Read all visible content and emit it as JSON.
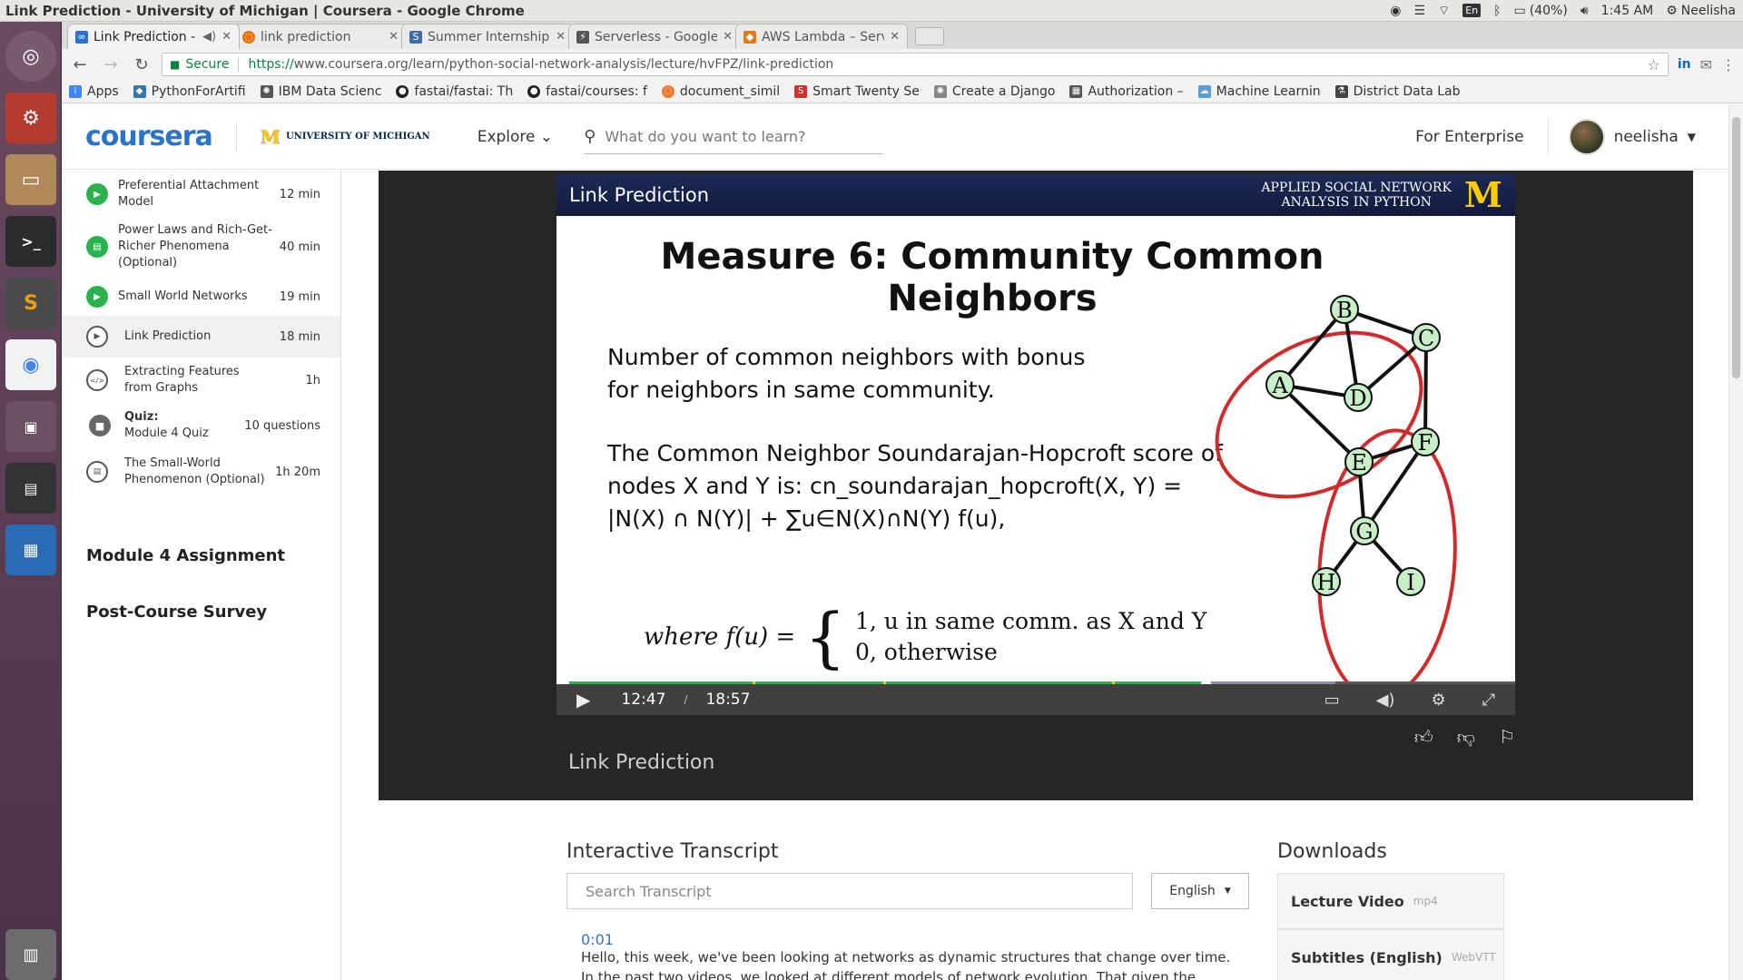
{
  "os": {
    "window_title": "Link Prediction - University of Michigan | Coursera - Google Chrome",
    "battery": "(40%)",
    "time": "1:45 AM",
    "user": "Neelisha",
    "keyboard": "En"
  },
  "browser": {
    "tabs": [
      {
        "label": "Link Prediction - ",
        "icon": "coursera-icon",
        "color": "#2a73cc",
        "active": true
      },
      {
        "label": "link prediction",
        "icon": "loading-icon",
        "color": "#e8710a",
        "active": false
      },
      {
        "label": "Summer Internship",
        "icon": "s-icon",
        "color": "#3a6ea5",
        "active": false
      },
      {
        "label": "Serverless - Google",
        "icon": "bolt-icon",
        "color": "#555555",
        "active": false
      },
      {
        "label": "AWS Lambda – Serv",
        "icon": "aws-icon",
        "color": "#e47911",
        "active": false
      }
    ],
    "secure_label": "Secure",
    "url_scheme": "https://",
    "url_host": "www.coursera.org",
    "url_path": "/learn/python-social-network-analysis/lecture/hvFPZ/link-prediction",
    "bookmarks": [
      {
        "label": "Apps",
        "color": "#4285f4"
      },
      {
        "label": "PythonForArtifi",
        "color": "#3776ab"
      },
      {
        "label": "IBM Data Scienc",
        "color": "#555555"
      },
      {
        "label": "fastai/fastai: Th",
        "color": "#222222"
      },
      {
        "label": "fastai/courses: f",
        "color": "#222222"
      },
      {
        "label": "document_simil",
        "color": "#f37626"
      },
      {
        "label": "Smart Twenty Se",
        "color": "#d32f2f"
      },
      {
        "label": "Create a Django",
        "color": "#888888"
      },
      {
        "label": "Authorization –",
        "color": "#555555"
      },
      {
        "label": "Machine Learnin",
        "color": "#5b9bd5"
      },
      {
        "label": "District Data Lab",
        "color": "#444444"
      }
    ]
  },
  "header": {
    "logo": "coursera",
    "university": "UNIVERSITY OF MICHIGAN",
    "explore": "Explore",
    "search_placeholder": "What do you want to learn?",
    "for_enterprise": "For Enterprise",
    "username": "neelisha"
  },
  "sidebar": {
    "items": [
      {
        "label": "Preferential Attachment Model",
        "duration": "12 min",
        "icon": "play-icon"
      },
      {
        "label": "Power Laws and Rich-Get-Richer Phenomena (Optional)",
        "duration": "40 min",
        "icon": "reading-icon"
      },
      {
        "label": "Small World Networks",
        "duration": "19 min",
        "icon": "play-icon"
      },
      {
        "label": "Link Prediction",
        "duration": "18 min",
        "icon": "play-icon"
      },
      {
        "label": "Extracting Features from Graphs",
        "duration": "1h",
        "icon": "code-icon"
      },
      {
        "label": "Module 4 Quiz",
        "quiz_label": "Quiz:",
        "duration": "10 questions",
        "icon": "lock-icon"
      },
      {
        "label": "The Small-World Phenomenon (Optional)",
        "duration": "1h 20m",
        "icon": "reading-icon"
      }
    ],
    "module_assignment": "Module 4 Assignment",
    "post_survey": "Post-Course Survey"
  },
  "slide": {
    "banner_left": "Link Prediction",
    "banner_right_1": "APPLIED SOCIAL NETWORK",
    "banner_right_2": "ANALYSIS IN PYTHON",
    "banner_logo": "M",
    "title": "Measure 6: Community Common Neighbors",
    "para1": "Number of common neighbors with bonus for neighbors in same community.",
    "para2": "The Common Neighbor Soundarajan-Hopcroft score of nodes X and Y is: cn_soundarajan_hopcroft(X, Y) = |N(X) ∩ N(Y)| + ∑u∈N(X)∩N(Y) f(u),",
    "formula_lhs": "where f(u) =",
    "case1": "1,  u in same comm. as X and Y",
    "case2": "0,  otherwise",
    "nodes": [
      "A",
      "B",
      "C",
      "D",
      "E",
      "F",
      "G",
      "H",
      "I"
    ]
  },
  "player": {
    "current_time": "12:47",
    "separator": "/",
    "duration": "18:57",
    "progress_fraction": 0.673,
    "buffered_fraction": 0.81,
    "video_title": "Link Prediction"
  },
  "transcript": {
    "heading": "Interactive Transcript",
    "search_placeholder": "Search Transcript",
    "language": "English",
    "timestamp": "0:01",
    "text": "Hello, this week, we've been looking at networks as dynamic structures that change over time. In the past two videos, we looked at different models of network evolution. That given the dynamics for"
  },
  "downloads": {
    "heading": "Downloads",
    "items": [
      {
        "title": "Lecture Video",
        "format": "mp4"
      },
      {
        "title": "Subtitles (English)",
        "format": "WebVTT"
      }
    ]
  },
  "colors": {
    "coursera_blue": "#2a73cc",
    "progress_green": "#2bb24c",
    "umich_maize": "#ffcb05",
    "umich_blue": "#00274c"
  }
}
